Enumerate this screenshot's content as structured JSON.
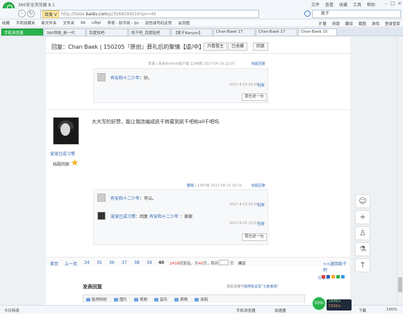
{
  "browser": {
    "title": "360安全浏览器 8.1",
    "menu": [
      "文件",
      "查看",
      "收藏",
      "工具",
      "帮助"
    ],
    "address_chip": "百度 V",
    "url_prefix": "http://tieba.",
    "url_host": "baidu.com",
    "url_path": "/p/3568294216?pn=40",
    "search_value": "凯千",
    "bookmarks": [
      "收藏",
      "手机收藏夹",
      "新文件夹",
      "文件夹",
      "bb",
      "u9gz",
      "李哥 - 射手网 - Sh",
      "双色球号码走势",
      "会员圈"
    ],
    "bookmarks_right": [
      "扩展",
      "网银",
      "翻译",
      "截图",
      "游戏",
      "登录管家"
    ],
    "tabs": [
      "手机浏览器",
      "360导航_新一代",
      "百度知吧-",
      "凯千吧_百度贴吧",
      "【凯千Kanyor】",
      "Chan·Baek 17",
      "Chan·Baek 17",
      "Chan·Baek 15"
    ]
  },
  "thread": {
    "title": "回复：Chan·Baek | 150205『原创』葬礼后的聚情【虐/中】",
    "buttons": [
      "只看楼主",
      "已收藏",
      "回复"
    ]
  },
  "reply1": {
    "meta_report": "举报",
    "meta_client": "来自Android客户端",
    "meta_floor": "1246楼",
    "meta_time": "2017-04-19 22:07",
    "toggle": "收起回复",
    "user": "有安和十二少年",
    "text": "好。",
    "time": "2017-4-23 20:09",
    "reply_btn": "回复",
    "say_btn": "我也说一句"
  },
  "post2": {
    "author_name": "宠宠已成习惯",
    "author_level": "线殿回家",
    "text": "大大写的好赞，能让我改编成凯千转载到凯千吧和all千吧吗",
    "meta_delete": "删除",
    "meta_floor": "1247楼",
    "meta_time": "2017-04-21 19:21",
    "toggle": "收起回复",
    "replies": [
      {
        "user": "有安和十二少年",
        "text": "可以。",
        "time": "2017-4-23 20:09",
        "btn": "回复"
      },
      {
        "user": "宠宠已成习惯",
        "mid": "回复",
        "target": "有安和十二少年",
        "text": "谢谢",
        "time": "2017-4-25 20:07",
        "btn": "回复"
      }
    ],
    "say_btn": "我也说一句"
  },
  "pager": {
    "first": "首页",
    "prev": "上一页",
    "pages": [
      "34",
      "35",
      "36",
      "37",
      "38",
      "39",
      "40"
    ],
    "current": "40",
    "total_replies": "2438",
    "replies_label": "回复贴，共",
    "total_pages": "40",
    "pages_label": "页，跳到",
    "page_unit": "页",
    "go": "确定",
    "back": "<<返回凯千吧"
  },
  "share_label": "分享到",
  "share_colors": [
    "#e03b3b",
    "#2d64b3",
    "#f3a52d",
    "#2bb24c",
    "#3b9be0"
  ],
  "compose": {
    "title": "发表回复",
    "note_prefix": "发贴请遵守",
    "note_link": "贴吧协议及\"七条底线\"",
    "tools": [
      "贴吧特权",
      "图片",
      "视频",
      "音乐",
      "表情",
      "涂鸦"
    ]
  },
  "side_tools": [
    "smile-icon",
    "plus-icon",
    "user-icon",
    "flask-icon",
    "up-arrow-icon"
  ],
  "statusbar": {
    "left": "今日特卖",
    "items": [
      "手机浏览器",
      "加速器",
      "下载"
    ],
    "zoom": "100%",
    "speed_percent": "50%",
    "up_rate": "184K/s",
    "down_rate": "532K/s"
  }
}
